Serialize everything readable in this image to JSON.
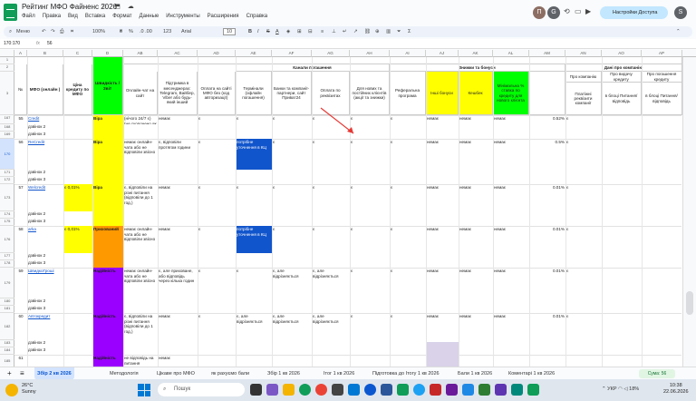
{
  "app": {
    "title": "Рейтинг МФО Файненс 2026",
    "menu": [
      "Файл",
      "Правка",
      "Вид",
      "Вставка",
      "Формат",
      "Данные",
      "Инструменты",
      "Расширения",
      "Справка"
    ],
    "share_label": "Настройки Доступа",
    "avatar_letter": "S",
    "account_letters": [
      "П",
      "G"
    ]
  },
  "toolbar": {
    "search_label": "Меню",
    "zoom": "100%",
    "currency": "₴",
    "percent": "%",
    "decimals": ".0 .00",
    "format_123": "123",
    "font": "Arial",
    "font_size": "10"
  },
  "formula_bar": {
    "cell_ref": "170:170",
    "fx": "fx",
    "value": "56"
  },
  "columns": [
    "A",
    "B",
    "C",
    "D",
    "AB",
    "AC",
    "AD",
    "AE",
    "AF",
    "AG",
    "AH",
    "AI",
    "AJ",
    "AK",
    "AL",
    "AM",
    "AN",
    "AO",
    "AP"
  ],
  "header": {
    "group_channels": "Канали погашення",
    "group_discounts": "Знижки та бонуси",
    "group_about": "Дані про компанію",
    "col_no": "№",
    "col_mfo": "МФО (онлайн )",
    "col_credit": "Ціна кредиту по МФО",
    "col_speed": "Швидкість /Звіт",
    "labels": [
      "Onлайн-чат на сайт",
      "Підтримка в месенджерах: Telegram, Вайбер, Viber або будь-який інший",
      "Оплата на сайті МФО без (код авторизації)",
      "Термінали (офлайн погашення)",
      "Банки та компанії-партнери, сайт Приват24",
      "Оплата по реквізитах",
      "Для нових та постійних клієнтів (акції та знижки)",
      "Реферальна програма",
      "Інші бонуси",
      "Кешбек",
      "Мінімальна % ставка по кредиту для нового клієнта",
      "Платіжні реквізити компанії",
      "в блоці Питання/відповідь",
      "в блоці Питання/відповідь"
    ],
    "about_labels": [
      "Про компанію",
      "Про видачу кредиту",
      "Про погашення кредиту"
    ]
  },
  "rows": [
    {
      "num": "55",
      "name": "Credit",
      "speed": "Віра",
      "speed_color": "#ffff00",
      "ab": "(нічого 24/7 є) (не скорочено як телефон це також)",
      "ac": "немає",
      "ad": "є",
      "ae": "є",
      "af": "є",
      "ag": "є",
      "ah": "є",
      "ai": "є",
      "aj": "немає",
      "ak": "немає",
      "al": "немає",
      "am": "0.52%",
      "an": "є"
    },
    {
      "num": "56",
      "name": "ReCredit",
      "speed": "Віра",
      "speed_color": "#ffff00",
      "ab": "немає онлайн-чата або не відповіли звісно",
      "ac": "є, відповіли протягом години",
      "ad": "є",
      "ae": "потрібне уточнення в КЦ",
      "af": "є",
      "ag": "є",
      "ah": "є",
      "ai": "є",
      "aj": "немає",
      "ak": "немає",
      "al": "немає",
      "am": "0.5%",
      "an": "є"
    },
    {
      "num": "57",
      "name": "Welcredit",
      "credit": "є 0,01%",
      "speed": "Віра",
      "speed_color": "#ffff00",
      "ab": "є, відповіли на різні питання (відповіли до 1 год.)",
      "ac": "немає",
      "ad": "є",
      "ae": "є",
      "af": "є",
      "ag": "є",
      "ah": "є",
      "ai": "є",
      "aj": "немає",
      "ak": "немає",
      "al": "немає",
      "am": "0.01%",
      "an": "є"
    },
    {
      "num": "58",
      "name": "arka",
      "credit": "є 0,01%",
      "speed": "Прихований",
      "speed_color": "#ff9900",
      "ab": "немає онлайн-чата або не відповіли звісно",
      "ac": "немає",
      "ad": "є",
      "ae": "потрібне уточнення в КЦ",
      "af": "є",
      "ag": "є",
      "ah": "є",
      "ai": "є",
      "aj": "немає",
      "ak": "немає",
      "al": "немає",
      "am": "0.01%",
      "an": "є"
    },
    {
      "num": "59",
      "name": "ШвидкоГроші",
      "speed": "Надійність",
      "speed_color": "#9900ff",
      "ab": "немає онлайн-чата або не відповіли звісно",
      "ac": "є, але приховане, або відповідь через кілька годин",
      "ad": "є",
      "ae": "є",
      "af": "є, але відрізняється",
      "ag": "є, але відрізняється",
      "ah": "є",
      "ai": "є",
      "aj": "немає",
      "ak": "немає",
      "al": "немає",
      "am": "0.01%",
      "an": "є"
    },
    {
      "num": "60",
      "name": "Автокредит",
      "speed": "Надійність",
      "speed_color": "#9900ff",
      "ab": "є, відповіли на різні питання (відповіли до 1 год.)",
      "ac": "немає",
      "ad": "є",
      "ae": "є, але відрізняється",
      "af": "є, але відрізняється",
      "ag": "є, але відрізняється",
      "ah": "є",
      "ai": "є",
      "aj": "немає",
      "ak": "немає",
      "al": "немає",
      "am": "0.01%",
      "an": "є"
    },
    {
      "num": "61",
      "name": "",
      "speed": "Надійність",
      "speed_color": "#9900ff",
      "ab": "не відповідь на питання",
      "ac": "немає",
      "ad": "",
      "ae": "",
      "af": "",
      "ag": "",
      "ah": "",
      "ai": "",
      "aj": "",
      "ak": "",
      "al": "",
      "am": "",
      "an": ""
    }
  ],
  "sub_rows": [
    "дзвінок 2",
    "дзвінок 3"
  ],
  "row_numbers": {
    "top": [
      "1",
      "2",
      "3"
    ],
    "r1": [
      "167",
      "168",
      "169"
    ],
    "r2": [
      "170",
      "171",
      "172"
    ],
    "r3": [
      "173",
      "174",
      "175"
    ],
    "r4": [
      "176",
      "177",
      "178"
    ],
    "r5": [
      "179",
      "180",
      "181"
    ],
    "r6": [
      "182",
      "183",
      "184"
    ],
    "r7": [
      "185"
    ]
  },
  "sheet_tabs": [
    "Збір 2 кв 2026",
    "Методологія",
    "Цікаве про МФО",
    "як рахуємо бали",
    "Збір 1 кв 2026",
    "Ітог 1 кв 2026",
    "Підготовка до Ітогу 1 кв 2026",
    "Бали 1 кв 2026",
    "Коментарі 1 кв 2026"
  ],
  "sum_label": "Сума: 56",
  "taskbar": {
    "weather_temp": "26°C",
    "weather_text": "Sunny",
    "search": "Пошук",
    "lang": "УКР",
    "battery": "18%",
    "time": "10:38",
    "date": "22.06.2026"
  },
  "colors": {
    "accent": "#0b57d0",
    "blue_cell": "#1155cc",
    "yellow": "#ffff00",
    "orange": "#ff9900",
    "purple": "#9900ff",
    "green": "#00ff00",
    "light_yellow": "#fff2cc"
  }
}
